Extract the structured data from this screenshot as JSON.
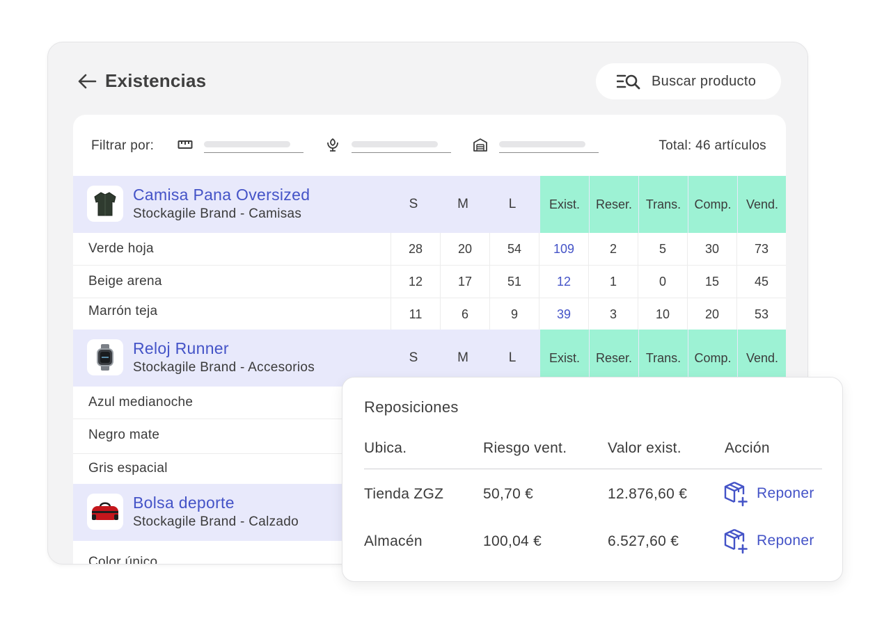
{
  "header": {
    "title": "Existencias",
    "search_label": "Buscar producto"
  },
  "filters": {
    "label": "Filtrar por:",
    "icons": [
      "ruler-icon",
      "flower-icon",
      "warehouse-icon"
    ],
    "total": "Total: 46 artículos"
  },
  "stat_headers": [
    "Exist.",
    "Reser.",
    "Trans.",
    "Comp.",
    "Vend."
  ],
  "size_headers": [
    "S",
    "M",
    "L"
  ],
  "products": [
    {
      "name": "Camisa Pana Oversized",
      "brand": "Stockagile Brand - Camisas",
      "thumb_icon": "shirt-icon",
      "variants": [
        {
          "name": "Verde hoja",
          "sizes": [
            "28",
            "20",
            "54"
          ],
          "stats": [
            "109",
            "2",
            "5",
            "30",
            "73"
          ]
        },
        {
          "name": "Beige arena",
          "sizes": [
            "12",
            "17",
            "51"
          ],
          "stats": [
            "12",
            "1",
            "0",
            "15",
            "45"
          ]
        },
        {
          "name": "Marrón teja",
          "sizes": [
            "11",
            "6",
            "9"
          ],
          "stats": [
            "39",
            "3",
            "10",
            "20",
            "53"
          ]
        }
      ]
    },
    {
      "name": "Reloj Runner",
      "brand": "Stockagile Brand - Accesorios",
      "thumb_icon": "watch-icon",
      "variants": [
        {
          "name": "Azul medianoche"
        },
        {
          "name": "Negro mate"
        },
        {
          "name": "Gris espacial"
        }
      ]
    },
    {
      "name": "Bolsa deporte",
      "brand": "Stockagile Brand - Calzado",
      "thumb_icon": "bag-icon",
      "variants": [
        {
          "name": "Color único"
        }
      ]
    }
  ],
  "reposiciones": {
    "title": "Reposiciones",
    "headers": [
      "Ubica.",
      "Riesgo vent.",
      "Valor exist.",
      "Acción"
    ],
    "rows": [
      {
        "location": "Tienda ZGZ",
        "risk": "50,70 €",
        "value": "12.876,60 €",
        "action": "Reponer"
      },
      {
        "location": "Almacén",
        "risk": "100,04 €",
        "value": "6.527,60 €",
        "action": "Reponer"
      }
    ]
  },
  "colors": {
    "accent": "#4453c7",
    "product_header_bg": "#e8e9fb",
    "stat_header_bg": "#9df2d4",
    "card_bg": "#f3f3f4"
  }
}
